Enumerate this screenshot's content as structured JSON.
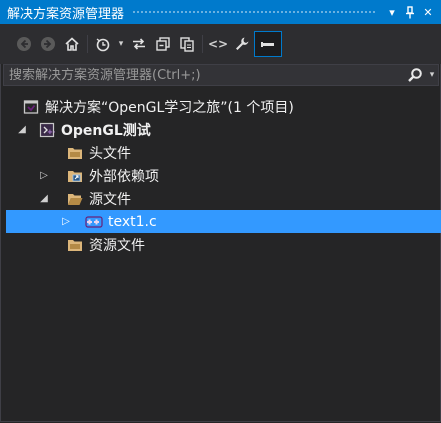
{
  "titlebar": {
    "title": "解决方案资源管理器",
    "dropdown_glyph": "▾",
    "pin_glyph": "⊥",
    "close_glyph": "✕"
  },
  "toolbar": {
    "dropdown_glyph": "▾",
    "brackets_glyph": "<>"
  },
  "search": {
    "placeholder": "搜索解决方案资源管理器(Ctrl+;)",
    "dropdown_glyph": "▾"
  },
  "tree": {
    "solution": {
      "label": "解决方案“OpenGL学习之旅”(1 个项目)",
      "icon": "solution-icon"
    },
    "project": {
      "label": "OpenGL测试",
      "icon": "cpp-project-icon",
      "expanded": true
    },
    "items": [
      {
        "label": "头文件",
        "icon": "folder-icon",
        "expandable": false
      },
      {
        "label": "外部依赖项",
        "icon": "external-dependencies-icon",
        "expandable": true,
        "expanded": false
      },
      {
        "label": "源文件",
        "icon": "folder-open-icon",
        "expandable": true,
        "expanded": true
      },
      {
        "label": "text1.c",
        "icon": "c-file-icon",
        "expandable": true,
        "expanded": false,
        "selected": true
      },
      {
        "label": "资源文件",
        "icon": "folder-icon",
        "expandable": false
      }
    ],
    "expanded_glyph": "◢",
    "collapsed_glyph": "▷"
  },
  "colors": {
    "accent": "#007acc",
    "selection": "#3399ff",
    "background": "#252526",
    "toolbar": "#2d2d30",
    "folder": "#dcb67a"
  }
}
